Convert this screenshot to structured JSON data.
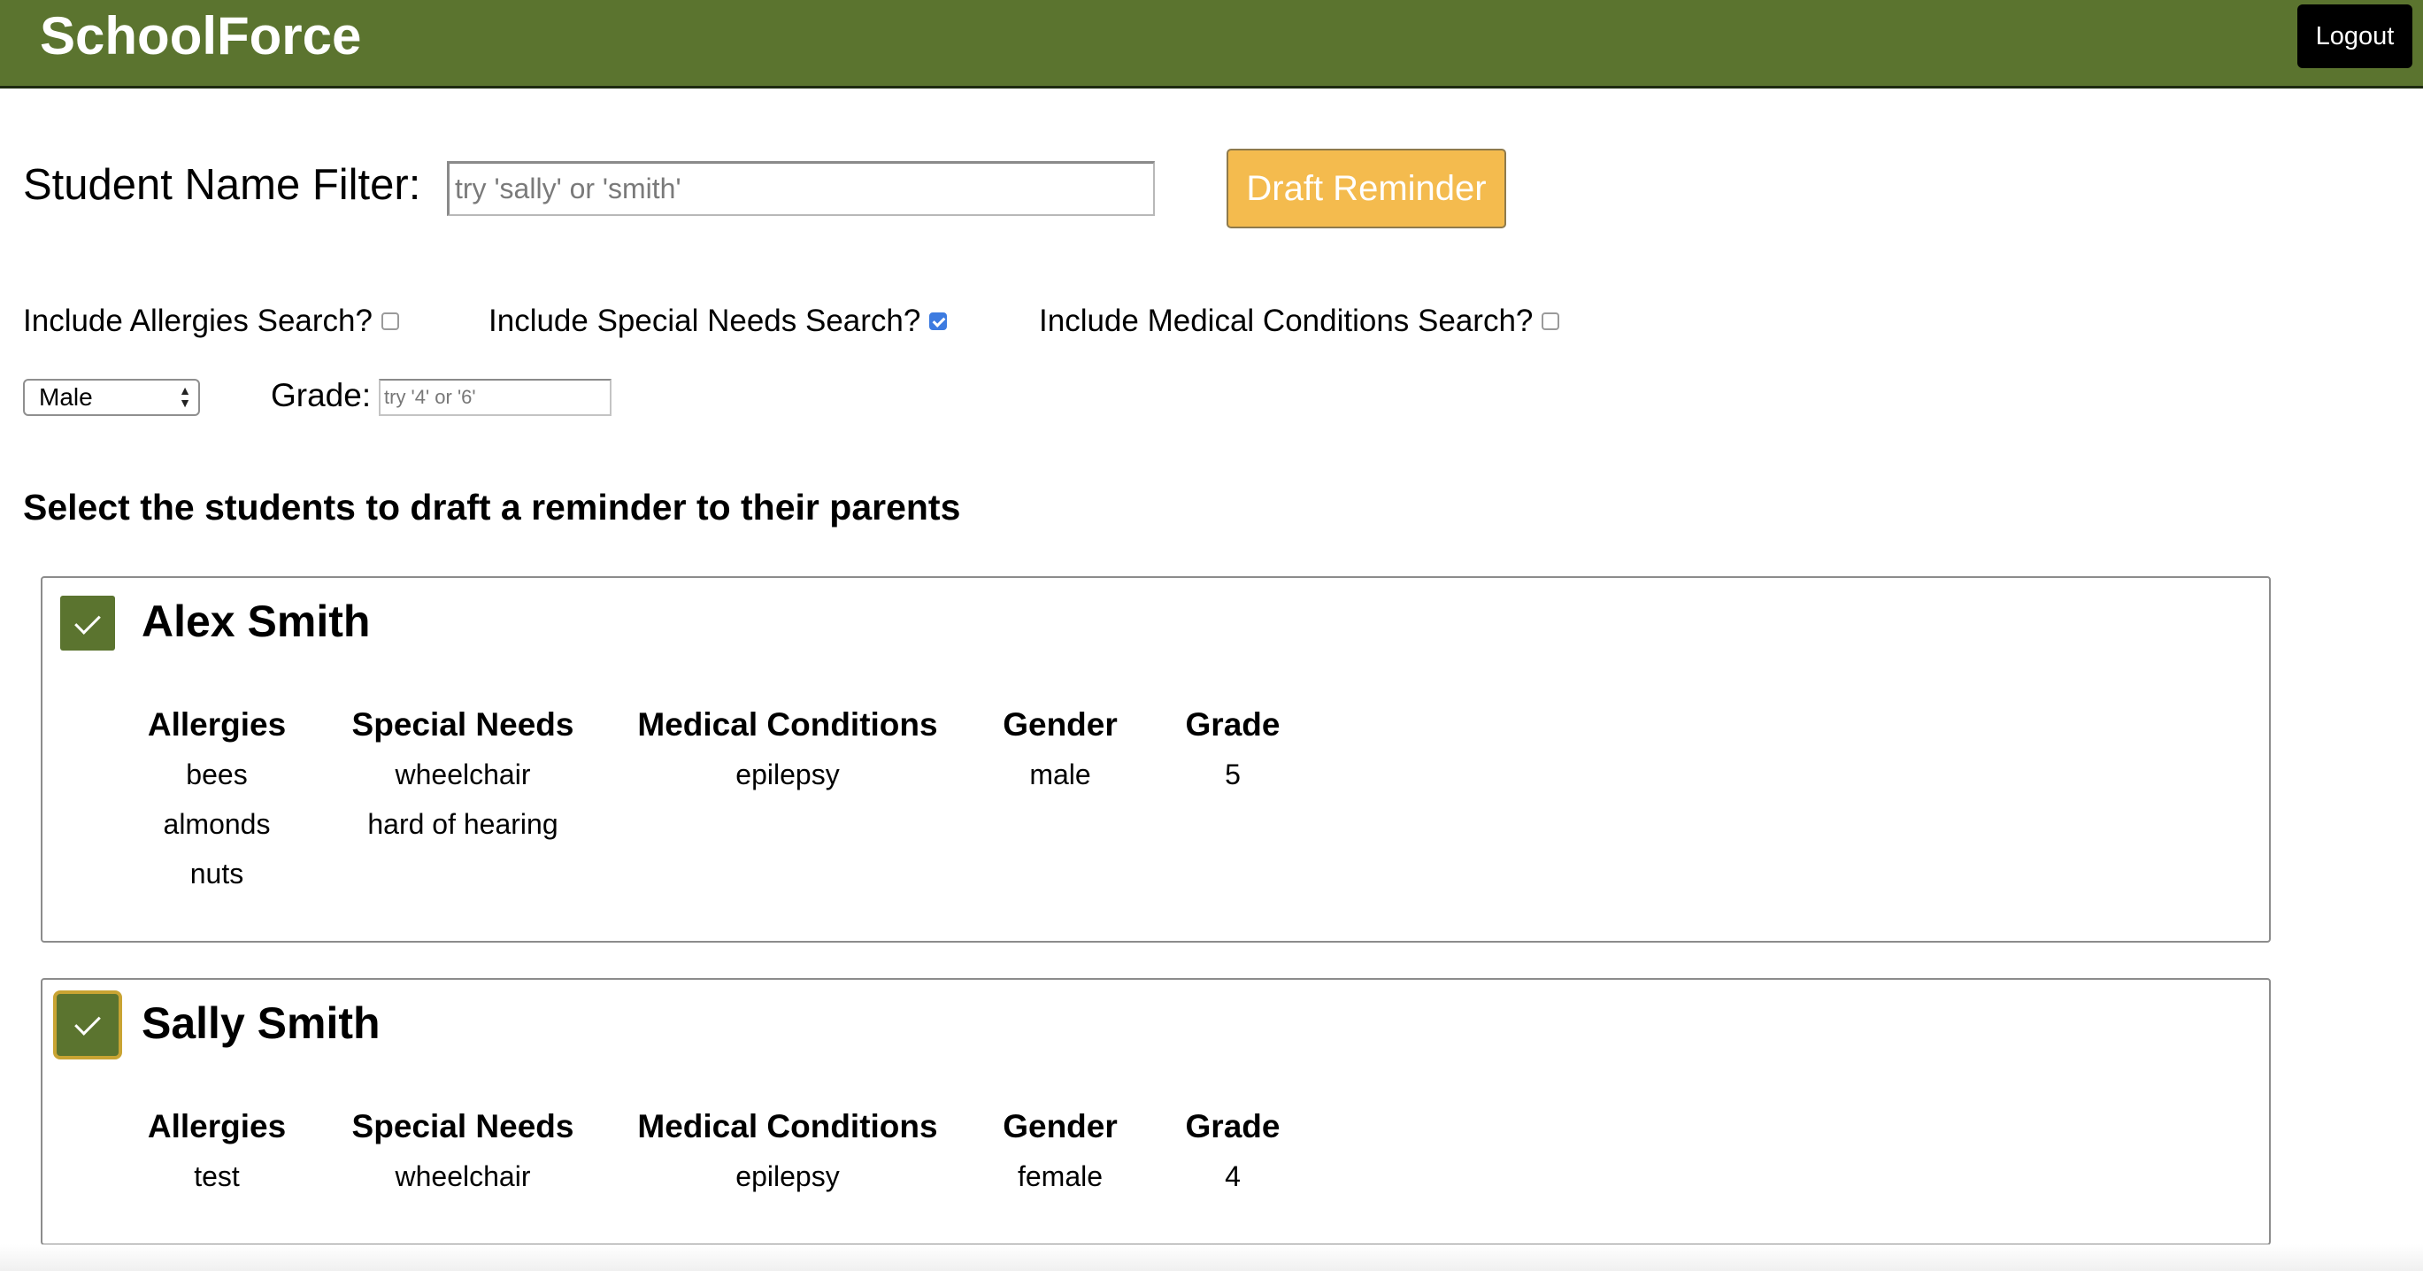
{
  "app": {
    "brand": "SchoolForce",
    "logout_label": "Logout"
  },
  "filters": {
    "name_label": "Student Name Filter:",
    "name_placeholder": "try 'sally' or 'smith'",
    "name_value": "",
    "draft_button_label": "Draft Reminder",
    "allergies_label": "Include Allergies Search?",
    "allergies_checked": false,
    "special_needs_label": "Include Special Needs Search?",
    "special_needs_checked": true,
    "medical_label": "Include Medical Conditions Search?",
    "medical_checked": false,
    "gender_selected": "Male",
    "grade_label": "Grade:",
    "grade_placeholder": "try '4' or '6'"
  },
  "section_title": "Select the students to draft a reminder to their parents",
  "column_headers": {
    "allergies": "Allergies",
    "special_needs": "Special Needs",
    "medical": "Medical Conditions",
    "gender": "Gender",
    "grade": "Grade"
  },
  "students": [
    {
      "name": "Alex Smith",
      "selected": true,
      "allergies": [
        "bees",
        "almonds",
        "nuts"
      ],
      "special_needs": [
        "wheelchair",
        "hard of hearing"
      ],
      "medical": [
        "epilepsy"
      ],
      "gender": "male",
      "grade": "5"
    },
    {
      "name": "Sally Smith",
      "selected": true,
      "allergies": [
        "test"
      ],
      "special_needs": [
        "wheelchair"
      ],
      "medical": [
        "epilepsy"
      ],
      "gender": "female",
      "grade": "4"
    }
  ],
  "colors": {
    "brand_green": "#5b742f",
    "draft_button": "#f4bb4e",
    "focus_ring": "#c9a433",
    "checkbox_blue": "#3d7be0"
  }
}
